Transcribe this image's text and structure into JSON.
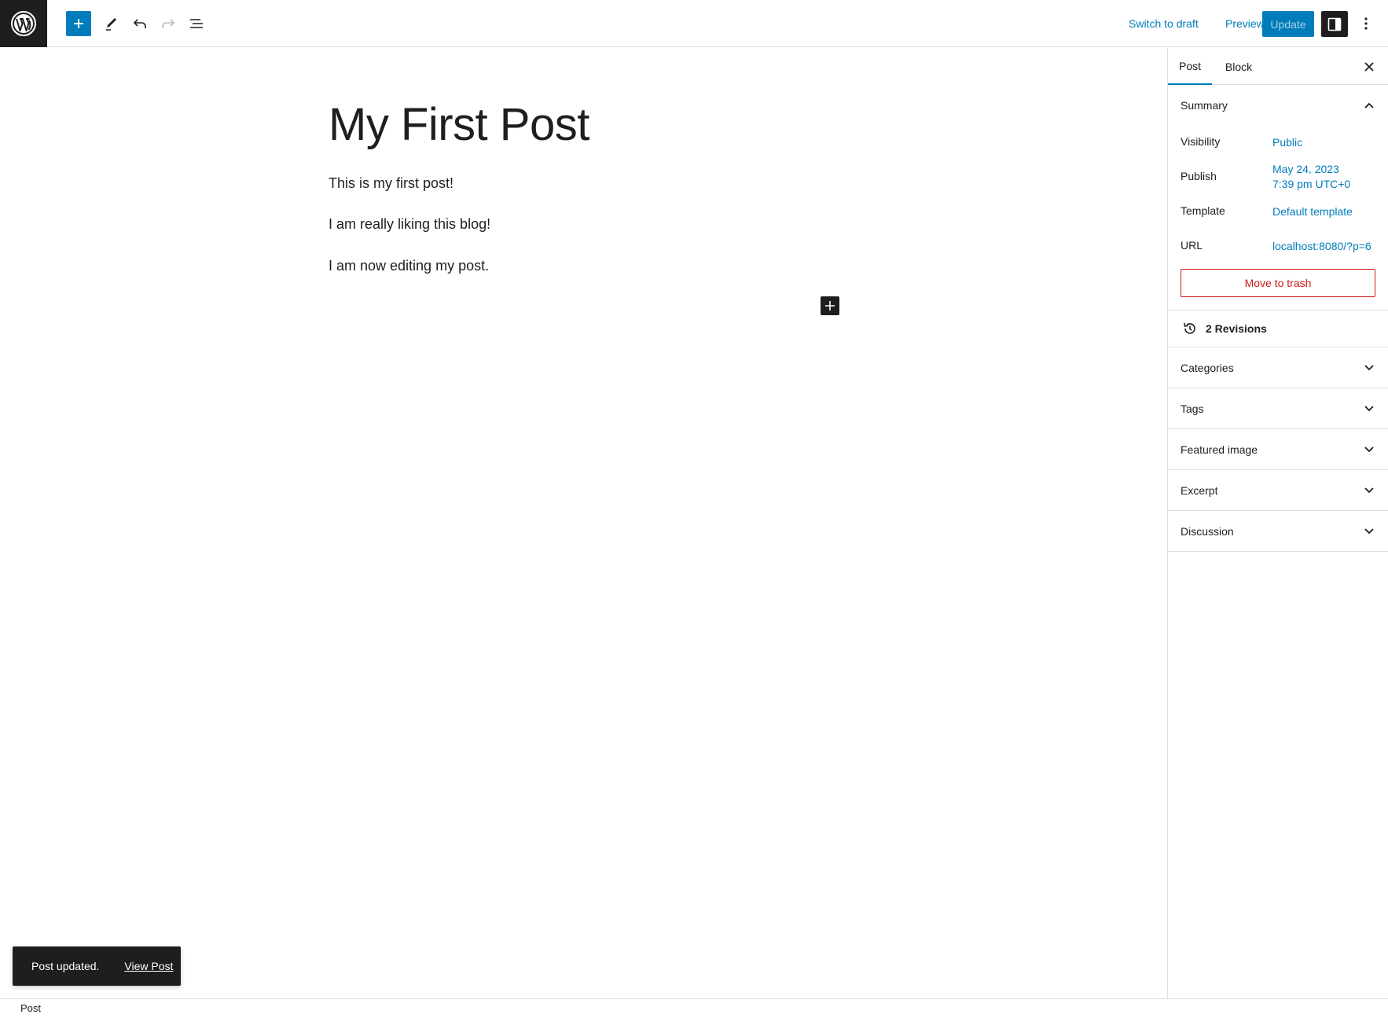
{
  "toolbar": {
    "logo_icon": "wordpress-icon",
    "inserter_icon": "plus-icon",
    "edit_icon": "pencil-icon",
    "undo_icon": "undo-icon",
    "redo_icon": "redo-icon",
    "list_view_icon": "list-view-icon",
    "switch_to_draft": "Switch to draft",
    "preview": "Preview",
    "update": "Update",
    "settings_icon": "sidebar-toggle-icon",
    "more_icon": "more-vertical-icon",
    "accent_color": "#007cba"
  },
  "editor": {
    "title": "My First Post",
    "paragraphs": [
      "This is my first post!",
      "I am really liking this blog!",
      "I am now editing my post."
    ]
  },
  "sidebar": {
    "tabs": [
      {
        "label": "Post",
        "active": true
      },
      {
        "label": "Block",
        "active": false
      }
    ],
    "summary": {
      "title": "Summary",
      "visibility_label": "Visibility",
      "visibility_value": "Public",
      "publish_label": "Publish",
      "publish_date": "May 24, 2023",
      "publish_time": "7:39 pm UTC+0",
      "template_label": "Template",
      "template_value": "Default template",
      "url_label": "URL",
      "url_value": "localhost:8080/?p=6",
      "trash_label": "Move to trash"
    },
    "revisions": "2 Revisions",
    "panels": [
      "Categories",
      "Tags",
      "Featured image",
      "Excerpt",
      "Discussion"
    ]
  },
  "snackbar": {
    "message": "Post updated.",
    "action": "View Post"
  },
  "footer": {
    "breadcrumb": "Post"
  }
}
